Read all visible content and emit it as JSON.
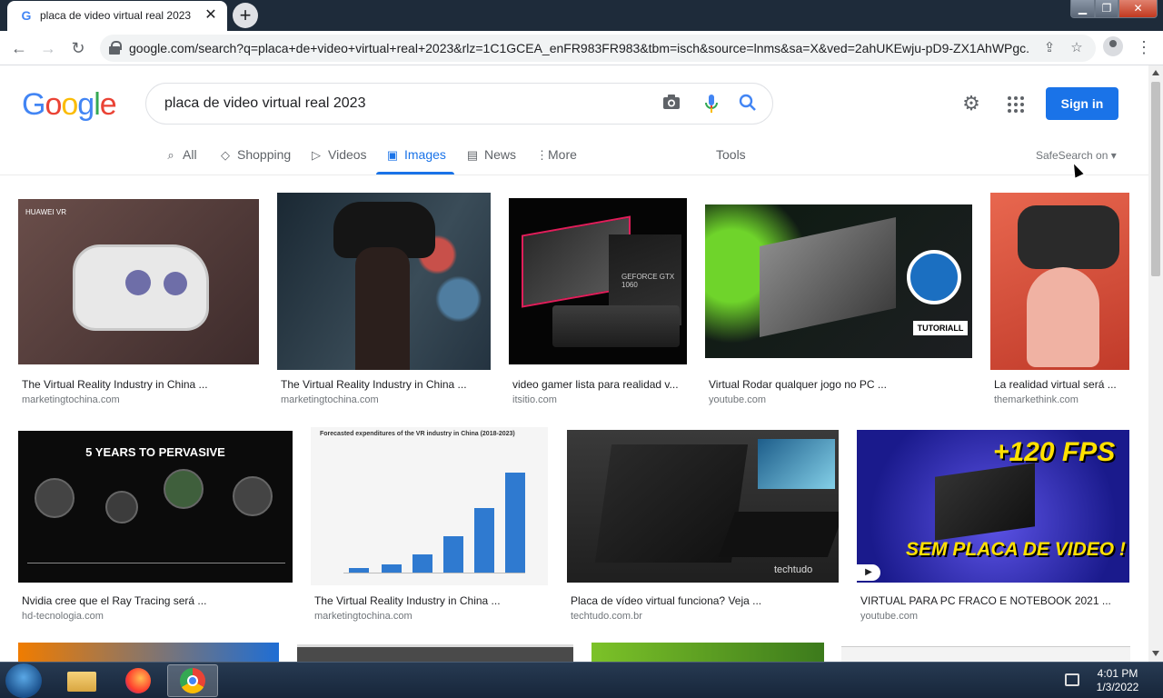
{
  "browser": {
    "tab_title": "placa de video virtual real 2023 -",
    "url": "google.com/search?q=placa+de+video+virtual+real+2023&rlz=1C1GCEA_enFR983FR983&tbm=isch&source=lnms&sa=X&ved=2ahUKEwju-pD9-ZX1AhWPgc..."
  },
  "google": {
    "logo": [
      "G",
      "o",
      "o",
      "g",
      "l",
      "e"
    ],
    "logo_colors": [
      "#4285f4",
      "#ea4335",
      "#fbbc05",
      "#4285f4",
      "#34a853",
      "#ea4335"
    ],
    "query": "placa de video virtual real 2023",
    "signin_label": "Sign in",
    "tabs": [
      {
        "label": "All",
        "icon": "search-icon"
      },
      {
        "label": "Shopping",
        "icon": "tag-icon"
      },
      {
        "label": "Videos",
        "icon": "play-icon"
      },
      {
        "label": "Images",
        "icon": "image-icon"
      },
      {
        "label": "News",
        "icon": "news-icon"
      },
      {
        "label": "More",
        "icon": "more-icon"
      }
    ],
    "tools_label": "Tools",
    "safesearch_label": "SafeSearch on"
  },
  "results": [
    {
      "title": "The Virtual Reality Industry in China ...",
      "source": "marketingtochina.com",
      "overlay": "HUAWEI VR"
    },
    {
      "title": "The Virtual Reality Industry in China ...",
      "source": "marketingtochina.com"
    },
    {
      "title": "video gamer lista para realidad v...",
      "source": "itsitio.com",
      "overlay": "GEFORCE GTX 1060"
    },
    {
      "title": "Virtual Rodar qualquer jogo no PC ...",
      "source": "youtube.com",
      "overlay": "TUTORIALL"
    },
    {
      "title": "La realidad virtual será ...",
      "source": "themarkethink.com"
    },
    {
      "title": "Nvidia cree que el Ray Tracing será ...",
      "source": "hd-tecnologia.com",
      "overlay": "5 YEARS TO PERVASIVE"
    },
    {
      "title": "The Virtual Reality Industry in China ...",
      "source": "marketingtochina.com",
      "overlay": "Forecasted expenditures of the VR industry in China (2018-2023)"
    },
    {
      "title": "Placa de vídeo virtual funciona? Veja ...",
      "source": "techtudo.com.br",
      "overlay": "techtudo"
    },
    {
      "title": "VIRTUAL PARA PC FRACO E NOTEBOOK 2021 ...",
      "source": "youtube.com",
      "overlay": "+120 FPS",
      "overlay2": "SEM PLACA DE VIDEO !"
    }
  ],
  "taskbar": {
    "time": "4:01 PM",
    "date": "1/3/2022"
  }
}
